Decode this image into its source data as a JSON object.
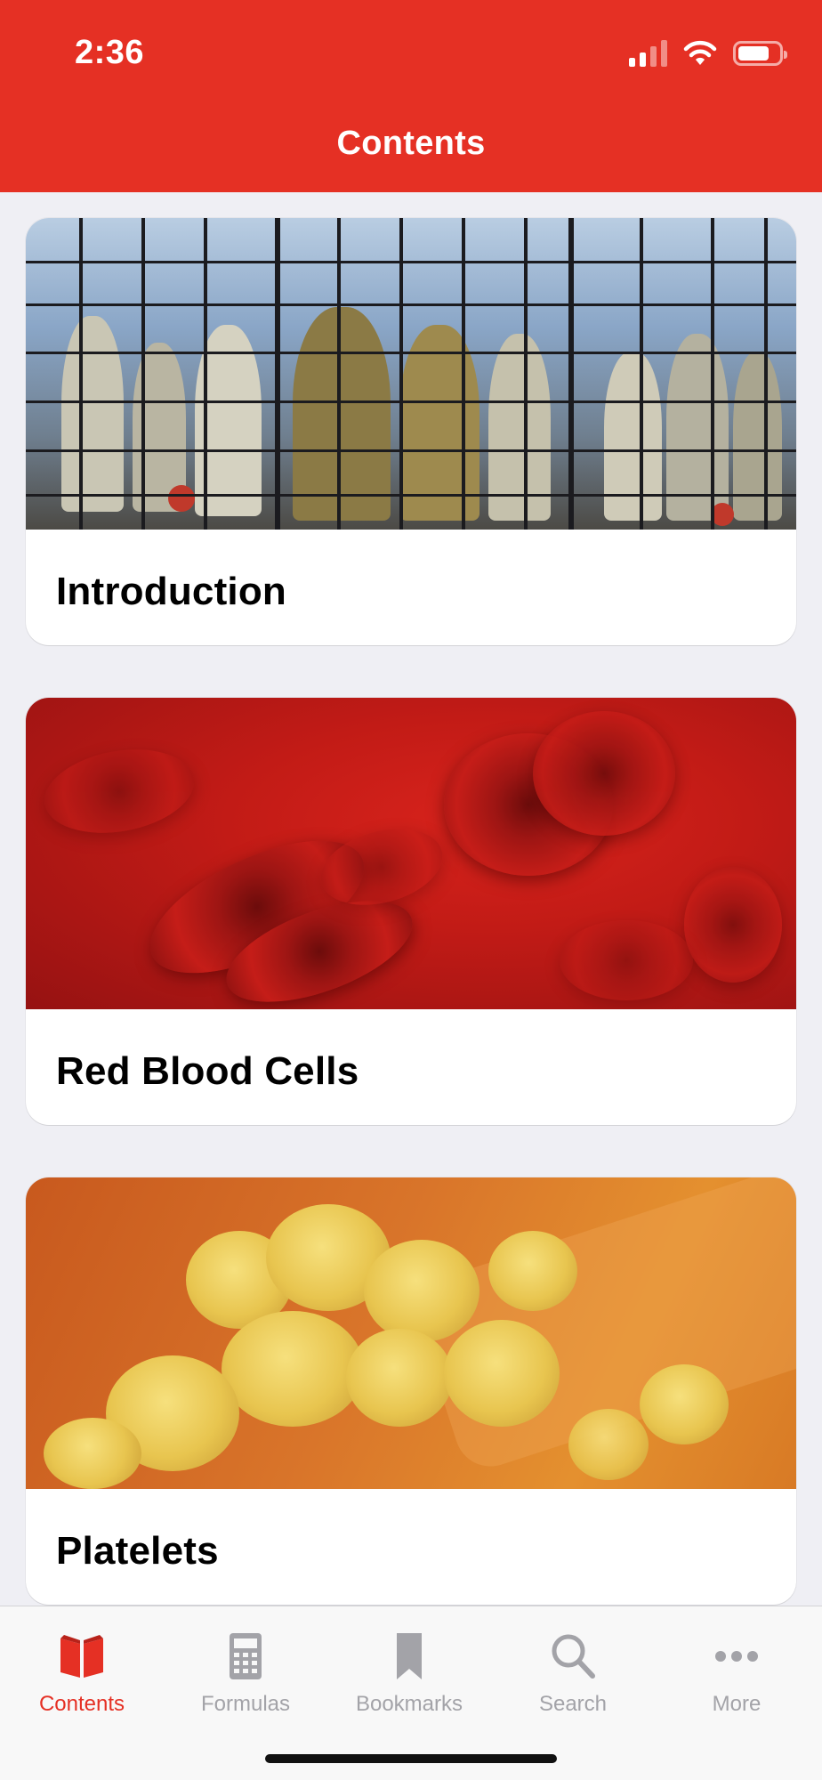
{
  "status_bar": {
    "time": "2:36"
  },
  "nav": {
    "title": "Contents"
  },
  "cards": [
    {
      "title": "Introduction"
    },
    {
      "title": "Red Blood Cells"
    },
    {
      "title": "Platelets"
    }
  ],
  "tabs": [
    {
      "label": "Contents",
      "icon": "book-icon",
      "active": true
    },
    {
      "label": "Formulas",
      "icon": "calculator-icon",
      "active": false
    },
    {
      "label": "Bookmarks",
      "icon": "bookmark-icon",
      "active": false
    },
    {
      "label": "Search",
      "icon": "search-icon",
      "active": false
    },
    {
      "label": "More",
      "icon": "more-icon",
      "active": false
    }
  ],
  "colors": {
    "accent": "#e53024",
    "tab_inactive": "#a3a3a8",
    "background": "#efeff4"
  }
}
